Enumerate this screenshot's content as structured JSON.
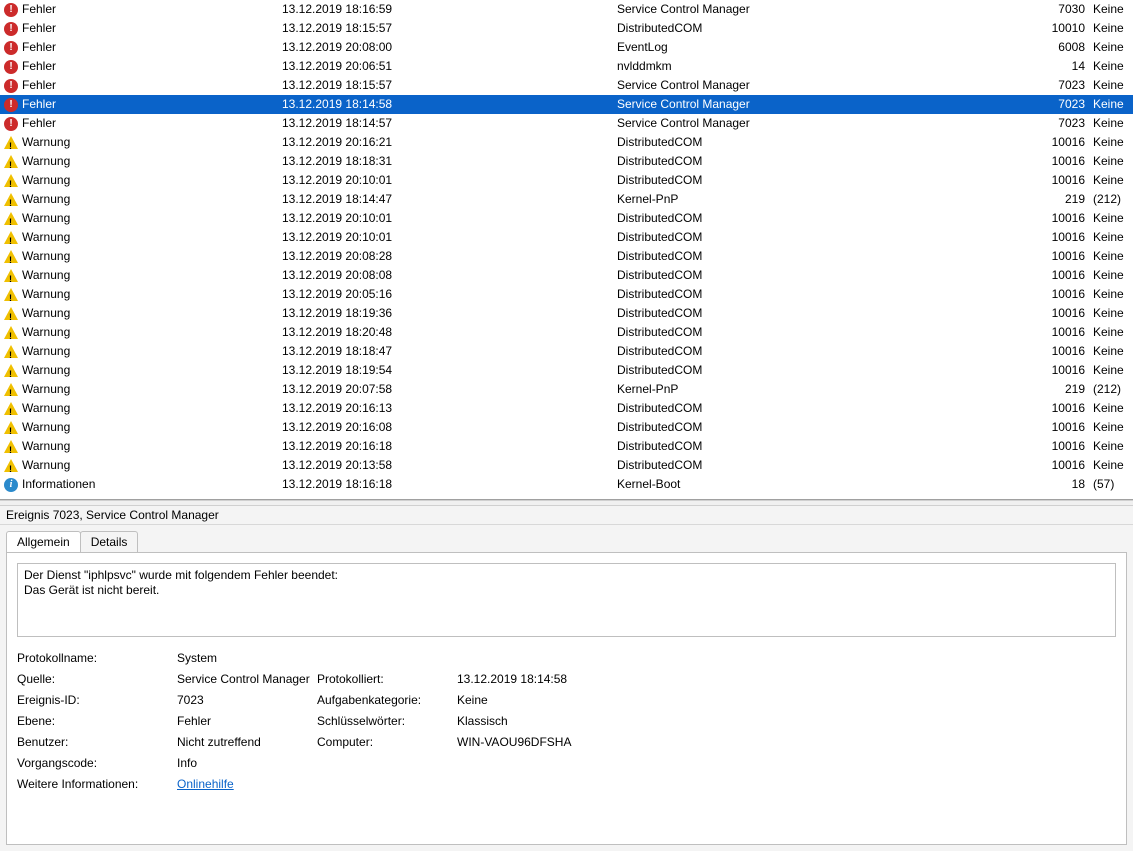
{
  "events": [
    {
      "level": "error",
      "levelText": "Fehler",
      "date": "13.12.2019 18:16:59",
      "source": "Service Control Manager",
      "eventId": "7030",
      "task": "Keine",
      "selected": false
    },
    {
      "level": "error",
      "levelText": "Fehler",
      "date": "13.12.2019 18:15:57",
      "source": "DistributedCOM",
      "eventId": "10010",
      "task": "Keine",
      "selected": false
    },
    {
      "level": "error",
      "levelText": "Fehler",
      "date": "13.12.2019 20:08:00",
      "source": "EventLog",
      "eventId": "6008",
      "task": "Keine",
      "selected": false
    },
    {
      "level": "error",
      "levelText": "Fehler",
      "date": "13.12.2019 20:06:51",
      "source": "nvlddmkm",
      "eventId": "14",
      "task": "Keine",
      "selected": false
    },
    {
      "level": "error",
      "levelText": "Fehler",
      "date": "13.12.2019 18:15:57",
      "source": "Service Control Manager",
      "eventId": "7023",
      "task": "Keine",
      "selected": false
    },
    {
      "level": "error",
      "levelText": "Fehler",
      "date": "13.12.2019 18:14:58",
      "source": "Service Control Manager",
      "eventId": "7023",
      "task": "Keine",
      "selected": true
    },
    {
      "level": "error",
      "levelText": "Fehler",
      "date": "13.12.2019 18:14:57",
      "source": "Service Control Manager",
      "eventId": "7023",
      "task": "Keine",
      "selected": false
    },
    {
      "level": "warning",
      "levelText": "Warnung",
      "date": "13.12.2019 20:16:21",
      "source": "DistributedCOM",
      "eventId": "10016",
      "task": "Keine",
      "selected": false
    },
    {
      "level": "warning",
      "levelText": "Warnung",
      "date": "13.12.2019 18:18:31",
      "source": "DistributedCOM",
      "eventId": "10016",
      "task": "Keine",
      "selected": false
    },
    {
      "level": "warning",
      "levelText": "Warnung",
      "date": "13.12.2019 20:10:01",
      "source": "DistributedCOM",
      "eventId": "10016",
      "task": "Keine",
      "selected": false
    },
    {
      "level": "warning",
      "levelText": "Warnung",
      "date": "13.12.2019 18:14:47",
      "source": "Kernel-PnP",
      "eventId": "219",
      "task": "(212)",
      "selected": false
    },
    {
      "level": "warning",
      "levelText": "Warnung",
      "date": "13.12.2019 20:10:01",
      "source": "DistributedCOM",
      "eventId": "10016",
      "task": "Keine",
      "selected": false
    },
    {
      "level": "warning",
      "levelText": "Warnung",
      "date": "13.12.2019 20:10:01",
      "source": "DistributedCOM",
      "eventId": "10016",
      "task": "Keine",
      "selected": false
    },
    {
      "level": "warning",
      "levelText": "Warnung",
      "date": "13.12.2019 20:08:28",
      "source": "DistributedCOM",
      "eventId": "10016",
      "task": "Keine",
      "selected": false
    },
    {
      "level": "warning",
      "levelText": "Warnung",
      "date": "13.12.2019 20:08:08",
      "source": "DistributedCOM",
      "eventId": "10016",
      "task": "Keine",
      "selected": false
    },
    {
      "level": "warning",
      "levelText": "Warnung",
      "date": "13.12.2019 20:05:16",
      "source": "DistributedCOM",
      "eventId": "10016",
      "task": "Keine",
      "selected": false
    },
    {
      "level": "warning",
      "levelText": "Warnung",
      "date": "13.12.2019 18:19:36",
      "source": "DistributedCOM",
      "eventId": "10016",
      "task": "Keine",
      "selected": false
    },
    {
      "level": "warning",
      "levelText": "Warnung",
      "date": "13.12.2019 18:20:48",
      "source": "DistributedCOM",
      "eventId": "10016",
      "task": "Keine",
      "selected": false
    },
    {
      "level": "warning",
      "levelText": "Warnung",
      "date": "13.12.2019 18:18:47",
      "source": "DistributedCOM",
      "eventId": "10016",
      "task": "Keine",
      "selected": false
    },
    {
      "level": "warning",
      "levelText": "Warnung",
      "date": "13.12.2019 18:19:54",
      "source": "DistributedCOM",
      "eventId": "10016",
      "task": "Keine",
      "selected": false
    },
    {
      "level": "warning",
      "levelText": "Warnung",
      "date": "13.12.2019 20:07:58",
      "source": "Kernel-PnP",
      "eventId": "219",
      "task": "(212)",
      "selected": false
    },
    {
      "level": "warning",
      "levelText": "Warnung",
      "date": "13.12.2019 20:16:13",
      "source": "DistributedCOM",
      "eventId": "10016",
      "task": "Keine",
      "selected": false
    },
    {
      "level": "warning",
      "levelText": "Warnung",
      "date": "13.12.2019 20:16:08",
      "source": "DistributedCOM",
      "eventId": "10016",
      "task": "Keine",
      "selected": false
    },
    {
      "level": "warning",
      "levelText": "Warnung",
      "date": "13.12.2019 20:16:18",
      "source": "DistributedCOM",
      "eventId": "10016",
      "task": "Keine",
      "selected": false
    },
    {
      "level": "warning",
      "levelText": "Warnung",
      "date": "13.12.2019 20:13:58",
      "source": "DistributedCOM",
      "eventId": "10016",
      "task": "Keine",
      "selected": false
    },
    {
      "level": "info",
      "levelText": "Informationen",
      "date": "13.12.2019 18:16:18",
      "source": "Kernel-Boot",
      "eventId": "18",
      "task": "(57)",
      "selected": false
    }
  ],
  "detailsHeader": "Ereignis 7023, Service Control Manager",
  "tabs": {
    "general": "Allgemein",
    "details": "Details"
  },
  "message": {
    "line1": "Der Dienst \"iphlpsvc\" wurde mit folgendem Fehler beendet:",
    "line2": "Das Gerät ist nicht bereit."
  },
  "labels": {
    "logName": "Protokollname:",
    "source": "Quelle:",
    "logged": "Protokolliert:",
    "eventId": "Ereignis-ID:",
    "taskCategory": "Aufgabenkategorie:",
    "level": "Ebene:",
    "keywords": "Schlüsselwörter:",
    "user": "Benutzer:",
    "computer": "Computer:",
    "opcode": "Vorgangscode:",
    "moreInfo": "Weitere Informationen:",
    "onlineHelp": "Onlinehilfe"
  },
  "detail": {
    "logName": "System",
    "source": "Service Control Manager",
    "logged": "13.12.2019 18:14:58",
    "eventId": "7023",
    "taskCategory": "Keine",
    "level": "Fehler",
    "keywords": "Klassisch",
    "user": "Nicht zutreffend",
    "computer": "WIN-VAOU96DFSHA",
    "opcode": "Info"
  }
}
